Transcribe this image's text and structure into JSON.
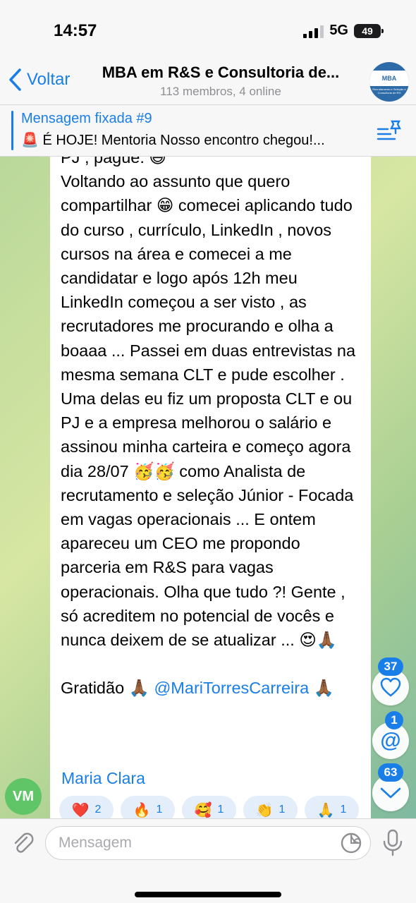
{
  "status": {
    "time": "14:57",
    "network": "5G",
    "battery": "49"
  },
  "header": {
    "back_label": "Voltar",
    "title": "MBA em R&S e Consultoria de...",
    "subtitle": "113 membros, 4 online",
    "avatar_logo": "MBA",
    "avatar_sub": "Recrutamento e Seleção e Consultoria de RH"
  },
  "pinned": {
    "title": "Mensagem fixada #9",
    "text": "🚨 É HOJE! Mentoria Nosso encontro chegou!..."
  },
  "message": {
    "top_partial": "PJ , pague. 😅",
    "body": "Voltando ao assunto que quero compartilhar 😁 comecei aplicando tudo do curso , currículo, LinkedIn , novos cursos na área e comecei a me candidatar e logo após 12h meu LinkedIn começou a ser visto , as recrutadores me procurando e olha a boaaa ... Passei em duas entrevistas na mesma semana CLT e pude escolher . Uma delas eu fiz um proposta CLT e ou PJ e a empresa melhorou o salário e assinou minha carteira e começo agora dia 28/07 🥳🥳 como Analista de recrutamento e seleção Júnior - Focada em vagas operacionais ... E ontem apareceu um CEO me propondo parceria em R&S para vagas operacionais. Olha que tudo ?! Gente , só acreditem no potencial de vocês e nunca deixem de se atualizar ... 😍🙏🏾",
    "thanks": "Gratidão 🙏🏾 ",
    "mention": "@MariTorresCarreira",
    "thanks_end": " 🙏🏾",
    "sender": "Maria Clara",
    "sender_initials": "VM",
    "reactions": [
      {
        "emoji": "❤️",
        "count": "2"
      },
      {
        "emoji": "🔥",
        "count": "1"
      },
      {
        "emoji": "🥰",
        "count": "1"
      },
      {
        "emoji": "👏",
        "count": "1"
      },
      {
        "emoji": "🙏",
        "count": "1"
      }
    ]
  },
  "floating": {
    "reactions_count": "37",
    "mentions_count": "1",
    "unread_count": "63"
  },
  "composer": {
    "placeholder": "Mensagem"
  },
  "colors": {
    "accent": "#1a7ee8",
    "avatar_vm": "#5fc566"
  }
}
